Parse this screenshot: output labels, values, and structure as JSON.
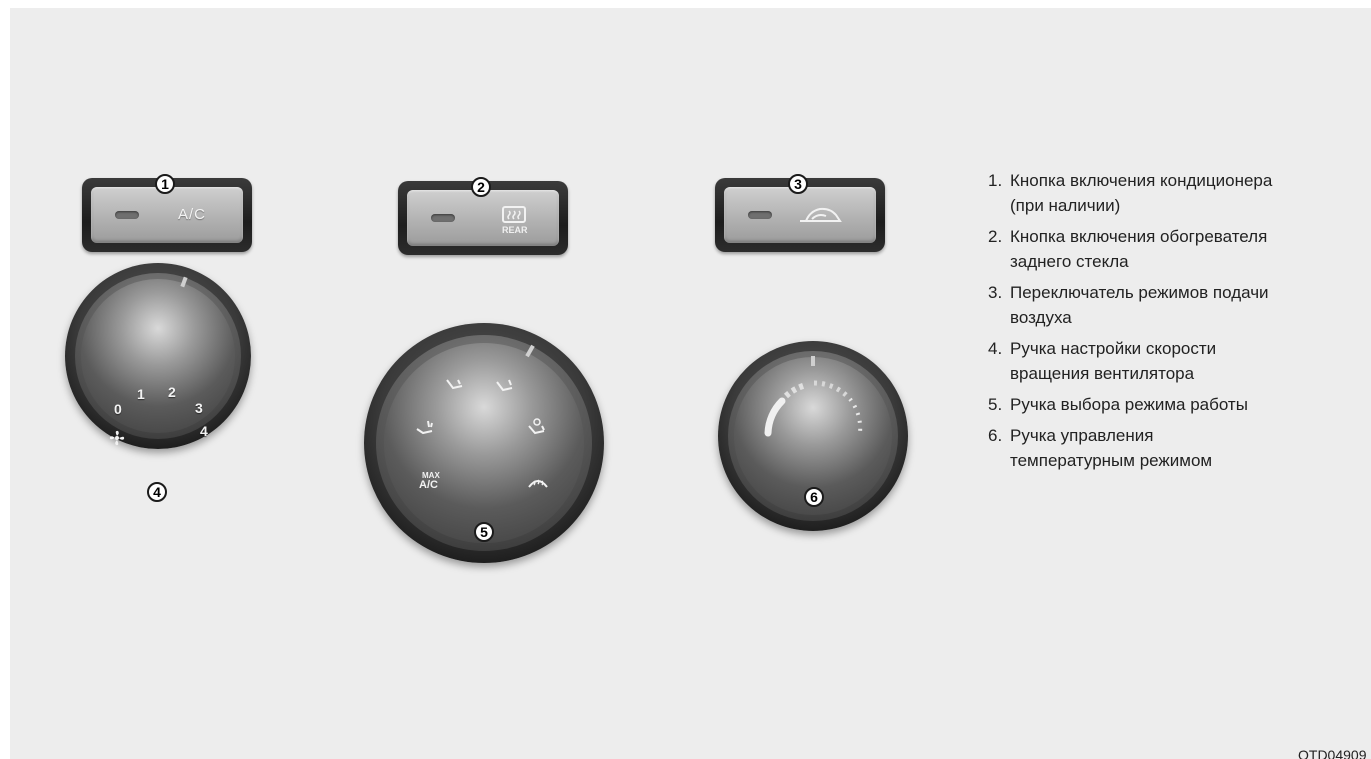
{
  "buttons": [
    {
      "callout": "1",
      "label": "A/C",
      "icon": "snowflake-less-ac-text"
    },
    {
      "callout": "2",
      "label": "REAR",
      "icon": "rear-defrost-icon"
    },
    {
      "callout": "3",
      "label": "",
      "icon": "air-recirculation-icon"
    }
  ],
  "knobs": {
    "fan": {
      "callout": "4",
      "speeds": [
        "0",
        "1",
        "2",
        "3",
        "4"
      ],
      "icon": "fan-icon"
    },
    "mode": {
      "callout": "5",
      "max_ac_top": "MAX",
      "max_ac_bottom": "A/C",
      "icons": [
        "face-vent-icon",
        "face-floor-icon",
        "floor-icon",
        "floor-defrost-icon",
        "defrost-icon"
      ]
    },
    "temp": {
      "callout": "6",
      "colors": {
        "cold": "#e8e8e8",
        "hot": "#ffffff"
      }
    }
  },
  "legend": [
    {
      "num": "1.",
      "text": "Кнопка включения кондиционера\n(при наличии)"
    },
    {
      "num": "2.",
      "text": "Кнопка включения обогревателя\nзаднего стекла"
    },
    {
      "num": "3.",
      "text": "Переключатель режимов подачи\nвоздуха"
    },
    {
      "num": "4.",
      "text": "Ручка настройки скорости\nвращения вентилятора"
    },
    {
      "num": "5.",
      "text": "Ручка выбора режима работы"
    },
    {
      "num": "6.",
      "text": "Ручка управления\nтемпературным режимом"
    }
  ],
  "figure_code": "OTD04909"
}
